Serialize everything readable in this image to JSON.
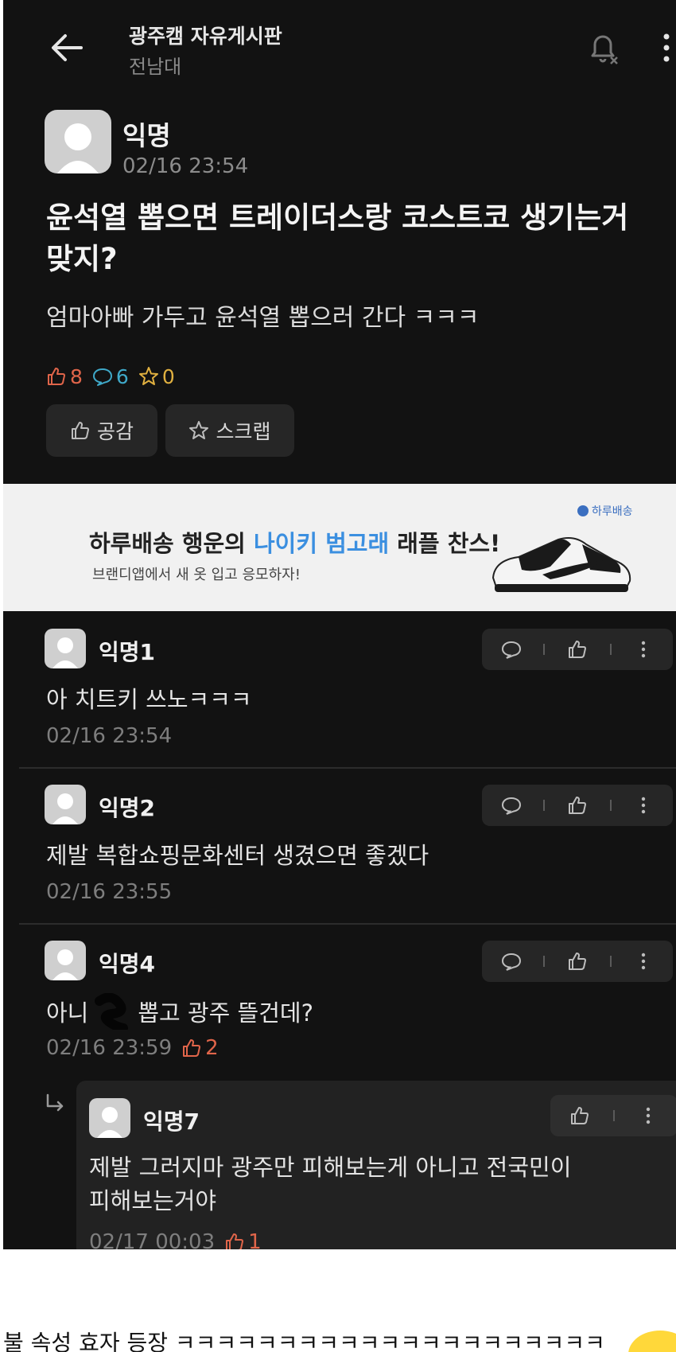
{
  "header": {
    "title": "광주캠 자유게시판",
    "subtitle": "전남대"
  },
  "post": {
    "author": "익명",
    "time": "02/16 23:54",
    "title": "윤석열 뽑으면 트레이더스랑 코스트코 생기는거 맞지?",
    "body": "엄마아빠 가두고 윤석열 뽑으러 간다 ㅋㅋㅋ",
    "likes": "8",
    "comments": "6",
    "scraps": "0",
    "like_button": "공감",
    "scrap_button": "스크랩"
  },
  "ad": {
    "headline_prefix": "하루배송 행운의 ",
    "headline_highlight": "나이키 범고래",
    "headline_suffix": " 래플 찬스!",
    "subtext": "브랜디앱에서 새 옷 입고 응모하자!",
    "logo": "하루배송"
  },
  "comments": [
    {
      "author": "익명1",
      "text": "아 치트키 쓰노ㅋㅋㅋ",
      "time": "02/16 23:54",
      "likes": ""
    },
    {
      "author": "익명2",
      "text": "제발 복합쇼핑문화센터 생겼으면 좋겠다",
      "time": "02/16 23:55",
      "likes": ""
    },
    {
      "author": "익명4",
      "text_before": "아니",
      "text_after": "뽑고 광주 뜰건데?",
      "time": "02/16 23:59",
      "likes": "2"
    }
  ],
  "reply": {
    "author": "익명7",
    "text_line1": "제발 그러지마 광주만 피해보는게 아니고 전국민이",
    "text_line2": "피해보는거야",
    "time": "02/17 00:03",
    "likes": "1"
  },
  "caption": "불 속성 효자 등장 ㅋㅋㅋㅋㅋㅋㅋㅋㅋㅋㅋㅋㅋㅋㅋㅋㅋㅋㅋㅋㅋ",
  "colors": {
    "background": "#121212",
    "like": "#e0654a",
    "comment": "#3fa9c9",
    "scrap": "#e0b040",
    "ad_highlight": "#3b8fe0"
  },
  "icons": [
    "back-arrow-icon",
    "bell-off-icon",
    "more-vert-icon",
    "thumbs-up-icon",
    "comment-icon",
    "star-icon",
    "reply-arrow-icon"
  ]
}
